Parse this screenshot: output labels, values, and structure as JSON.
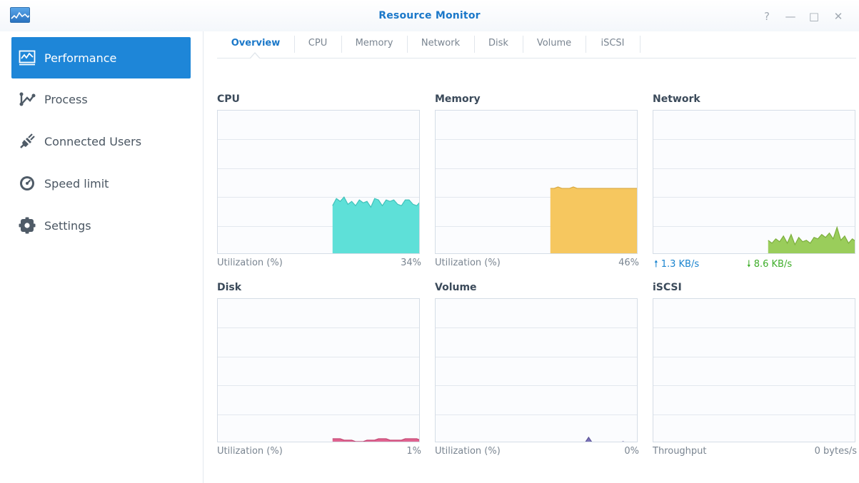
{
  "window": {
    "title": "Resource Monitor",
    "controls": {
      "help": "?",
      "minimize": "—",
      "maximize": "□",
      "close": "✕"
    }
  },
  "sidebar": {
    "items": [
      {
        "label": "Performance",
        "icon": "performance-chart-icon",
        "active": true
      },
      {
        "label": "Process",
        "icon": "process-icon",
        "active": false
      },
      {
        "label": "Connected Users",
        "icon": "plug-icon",
        "active": false
      },
      {
        "label": "Speed limit",
        "icon": "speedometer-icon",
        "active": false
      },
      {
        "label": "Settings",
        "icon": "gear-icon",
        "active": false
      }
    ]
  },
  "tabs": [
    "Overview",
    "CPU",
    "Memory",
    "Network",
    "Disk",
    "Volume",
    "iSCSI"
  ],
  "active_tab": "Overview",
  "panels": {
    "cpu": {
      "title": "CPU",
      "metric": "Utilization (%)",
      "value": "34%",
      "color": "#5ee0d8"
    },
    "memory": {
      "title": "Memory",
      "metric": "Utilization (%)",
      "value": "46%",
      "color": "#f6c75f"
    },
    "network": {
      "title": "Network",
      "upload": "1.3 KB/s",
      "download": "8.6 KB/s",
      "upload_arrow": "🠕",
      "download_arrow": "🠗",
      "color": "#9acd5b",
      "upload_color": "#1a84cf",
      "download_color": "#3fae2a"
    },
    "disk": {
      "title": "Disk",
      "metric": "Utilization (%)",
      "value": "1%",
      "color": "#e0628f"
    },
    "volume": {
      "title": "Volume",
      "metric": "Utilization (%)",
      "value": "0%",
      "color": "#7b72b8"
    },
    "iscsi": {
      "title": "iSCSI",
      "metric": "Throughput",
      "value": "0 bytes/s",
      "color": "#9bb4cc"
    }
  },
  "chart_data": [
    {
      "type": "area",
      "title": "CPU",
      "ylabel": "Utilization (%)",
      "ylim": [
        0,
        100
      ],
      "grid": true,
      "series": [
        {
          "values": [
            null,
            null,
            null,
            null,
            null,
            null,
            null,
            null,
            null,
            null,
            null,
            null,
            null,
            null,
            null,
            null,
            null,
            null,
            null,
            null,
            null,
            null,
            null,
            null,
            null,
            null,
            null,
            null,
            null,
            null,
            34,
            39,
            37,
            40,
            35,
            37,
            34,
            38,
            36,
            37,
            33,
            39,
            38,
            34,
            38,
            37,
            38,
            35,
            34,
            38,
            38,
            35,
            34,
            37
          ]
        }
      ]
    },
    {
      "type": "area",
      "title": "Memory",
      "ylabel": "Utilization (%)",
      "ylim": [
        0,
        100
      ],
      "grid": true,
      "series": [
        {
          "values": [
            null,
            null,
            null,
            null,
            null,
            null,
            null,
            null,
            null,
            null,
            null,
            null,
            null,
            null,
            null,
            null,
            null,
            null,
            null,
            null,
            null,
            null,
            null,
            null,
            null,
            null,
            null,
            null,
            null,
            null,
            46,
            46,
            47,
            46,
            46,
            46,
            47,
            46,
            46,
            46,
            46,
            46,
            46,
            46,
            46,
            46,
            46,
            46,
            46,
            46,
            46,
            46,
            46,
            46
          ]
        }
      ]
    },
    {
      "type": "area",
      "title": "Network",
      "ylim": [
        0,
        100
      ],
      "grid": true,
      "series": [
        {
          "values": [
            null,
            null,
            null,
            null,
            null,
            null,
            null,
            null,
            null,
            null,
            null,
            null,
            null,
            null,
            null,
            null,
            null,
            null,
            null,
            null,
            null,
            null,
            null,
            null,
            null,
            null,
            null,
            null,
            null,
            null,
            10,
            8,
            11,
            9,
            13,
            8,
            14,
            7,
            12,
            9,
            10,
            8,
            12,
            11,
            14,
            12,
            15,
            11,
            19,
            10,
            13,
            8,
            11,
            9
          ]
        }
      ]
    },
    {
      "type": "area",
      "title": "Disk",
      "ylabel": "Utilization (%)",
      "ylim": [
        0,
        100
      ],
      "grid": true,
      "series": [
        {
          "values": [
            null,
            null,
            null,
            null,
            null,
            null,
            null,
            null,
            null,
            null,
            null,
            null,
            null,
            null,
            null,
            null,
            null,
            null,
            null,
            null,
            null,
            null,
            null,
            null,
            null,
            null,
            null,
            null,
            null,
            null,
            3,
            3,
            3,
            2,
            2,
            2,
            1,
            1,
            1,
            2,
            2,
            2,
            3,
            3,
            3,
            2,
            2,
            2,
            2,
            3,
            3,
            3,
            3,
            2
          ]
        }
      ]
    },
    {
      "type": "area",
      "title": "Volume",
      "ylabel": "Utilization (%)",
      "ylim": [
        0,
        100
      ],
      "grid": true,
      "series": [
        {
          "values": [
            null,
            null,
            null,
            null,
            null,
            null,
            null,
            null,
            null,
            null,
            null,
            null,
            null,
            null,
            null,
            null,
            null,
            null,
            null,
            null,
            null,
            null,
            null,
            null,
            null,
            null,
            null,
            null,
            null,
            null,
            0,
            0,
            0,
            0,
            0,
            0,
            0,
            0,
            0,
            0,
            4,
            0,
            0,
            0,
            0,
            0,
            0,
            0,
            0,
            1,
            0,
            0,
            0,
            0
          ]
        }
      ]
    },
    {
      "type": "area",
      "title": "iSCSI",
      "ylabel": "Throughput",
      "ylim": [
        0,
        100
      ],
      "grid": true,
      "series": [
        {
          "values": [
            null,
            null,
            null,
            null,
            null,
            null,
            null,
            null,
            null,
            null,
            null,
            null,
            null,
            null,
            null,
            null,
            null,
            null,
            null,
            null,
            null,
            null,
            null,
            null,
            null,
            null,
            null,
            null,
            null,
            null,
            0,
            0,
            0,
            0,
            0,
            0,
            0,
            0,
            0,
            0,
            0,
            0,
            0,
            0,
            0,
            0,
            0,
            0,
            0,
            0,
            0,
            0,
            0,
            0
          ]
        }
      ]
    }
  ]
}
